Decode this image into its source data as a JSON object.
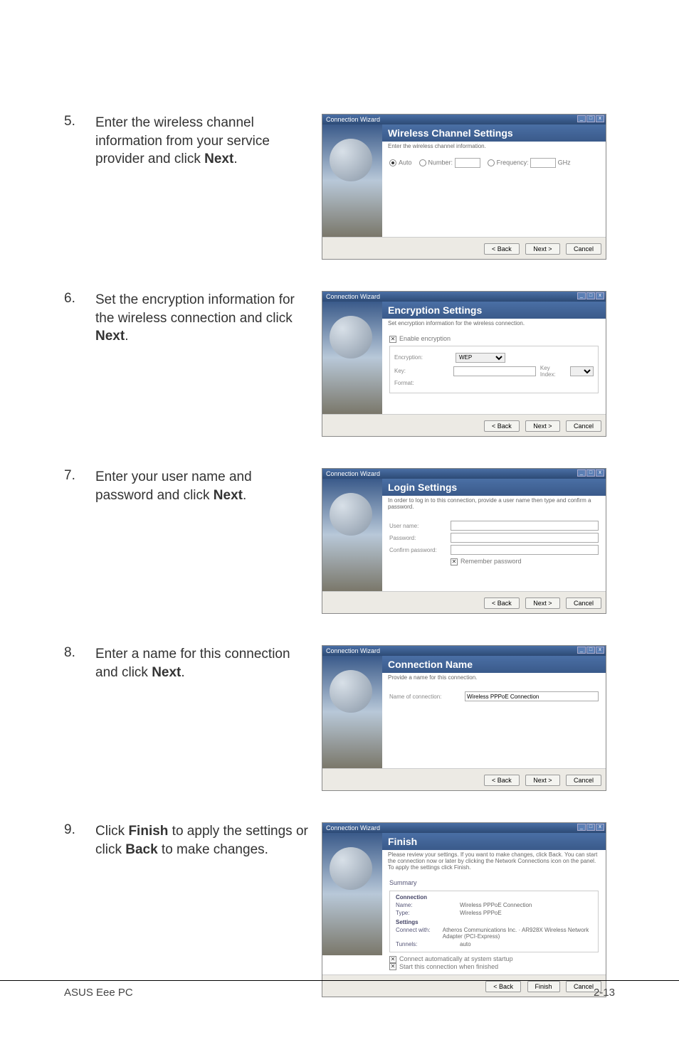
{
  "steps": {
    "s5": {
      "num": "5.",
      "text_a": "Enter the wireless channel information from your service provider and click ",
      "bold": "Next",
      "text_b": "."
    },
    "s6": {
      "num": "6.",
      "text_a": "Set the encryption information for the wireless connection and click ",
      "bold": "Next",
      "text_b": "."
    },
    "s7": {
      "num": "7.",
      "text_a": "Enter your user name and password and click ",
      "bold": "Next",
      "text_b": "."
    },
    "s8": {
      "num": "8.",
      "text_a": "Enter a name for this connection and click ",
      "bold": "Next",
      "text_b": "."
    },
    "s9": {
      "num": "9.",
      "text_a": "Click ",
      "bold1": "Finish",
      "mid": " to apply the settings or click ",
      "bold2": "Back",
      "text_b": " to make changes."
    }
  },
  "wiz_title": "Connection Wizard",
  "buttons": {
    "back": "< Back",
    "next": "Next >",
    "cancel": "Cancel",
    "finish": "Finish"
  },
  "d5": {
    "header": "Wireless Channel Settings",
    "sub": "Enter the wireless channel information.",
    "auto": "Auto",
    "number": "Number:",
    "frequency": "Frequency:",
    "ghz": "GHz"
  },
  "d6": {
    "header": "Encryption Settings",
    "sub": "Set encryption information for the wireless connection.",
    "enable": "Enable encryption",
    "group": "Encryption",
    "enc_label": "Encryption:",
    "enc_value": "WEP",
    "key": "Key:",
    "format": "Format:",
    "keyindex": "Key Index:"
  },
  "d7": {
    "header": "Login Settings",
    "sub": "In order to log in to this connection, provide a user name then type and confirm a password.",
    "username": "User name:",
    "password": "Password:",
    "confirm": "Confirm password:",
    "remember": "Remember password"
  },
  "d8": {
    "header": "Connection Name",
    "sub": "Provide a name for this connection.",
    "label": "Name of connection:",
    "value": "Wireless PPPoE Connection"
  },
  "d9": {
    "header": "Finish",
    "sub": "Please review your settings. If you want to make changes, click Back. You can start the connection now or later by clicking the Network Connections icon on the panel. To apply the settings click Finish.",
    "summary": "Summary",
    "conn_hdr": "Connection",
    "name_k": "Name:",
    "name_v": "Wireless PPPoE Connection",
    "type_k": "Type:",
    "type_v": "Wireless PPPoE",
    "set_hdr": "Settings",
    "cw_k": "Connect with:",
    "cw_v": "Atheros Communications Inc. · AR928X Wireless Network Adapter (PCI-Express)",
    "tun_k": "Tunnels:",
    "tun_v": "auto",
    "cb1": "Connect automatically at system startup",
    "cb2": "Start this connection when finished"
  },
  "footer": {
    "left": "ASUS Eee PC",
    "right": "2-13"
  }
}
